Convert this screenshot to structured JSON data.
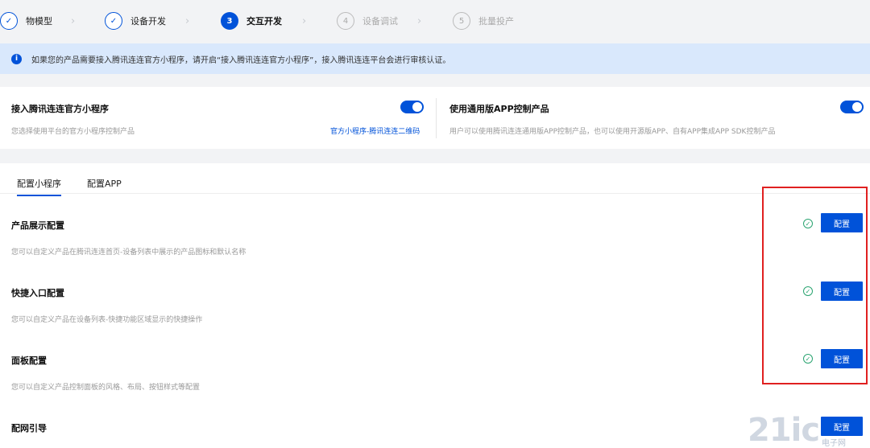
{
  "steps": [
    {
      "num": "✓",
      "label": "物模型",
      "state": "done"
    },
    {
      "num": "✓",
      "label": "设备开发",
      "state": "done"
    },
    {
      "num": "3",
      "label": "交互开发",
      "state": "active"
    },
    {
      "num": "4",
      "label": "设备调试",
      "state": "pending"
    },
    {
      "num": "5",
      "label": "批量投产",
      "state": "pending"
    }
  ],
  "notice": {
    "icon": "info-icon",
    "text": "如果您的产品需要接入腾讯连连官方小程序，请开启“接入腾讯连连官方小程序”，接入腾讯连连平台会进行审核认证。"
  },
  "access": {
    "left": {
      "title": "接入腾讯连连官方小程序",
      "desc": "您选择使用平台的官方小程序控制产品",
      "link": "官方小程序-腾讯连连二维码",
      "enabled": true
    },
    "right": {
      "title": "使用通用版APP控制产品",
      "desc": "用户可以使用腾讯连连通用版APP控制产品，也可以使用开源版APP、自有APP集成APP SDK控制产品",
      "enabled": true
    }
  },
  "tabs": [
    "配置小程序",
    "配置APP"
  ],
  "active_tab": "配置小程序",
  "config_items": [
    {
      "title": "产品展示配置",
      "desc": "您可以自定义产品在腾讯连连首页-设备列表中展示的产品图标和默认名称",
      "button": "配置",
      "done": true
    },
    {
      "title": "快捷入口配置",
      "desc": "您可以自定义产品在设备列表-快捷功能区域显示的快捷操作",
      "button": "配置",
      "done": true
    },
    {
      "title": "面板配置",
      "desc": "您可以自定义产品控制面板的风格、布局、按钮样式等配置",
      "button": "配置",
      "done": true
    },
    {
      "title": "配网引导",
      "desc": "",
      "button": "配置",
      "done": false
    }
  ],
  "watermark": {
    "big": "21ic",
    "small": "电子网"
  },
  "colors": {
    "primary": "#0052d9",
    "success": "#2ba471",
    "highlight": "#e02020",
    "notice_bg": "#d9e8fc"
  }
}
